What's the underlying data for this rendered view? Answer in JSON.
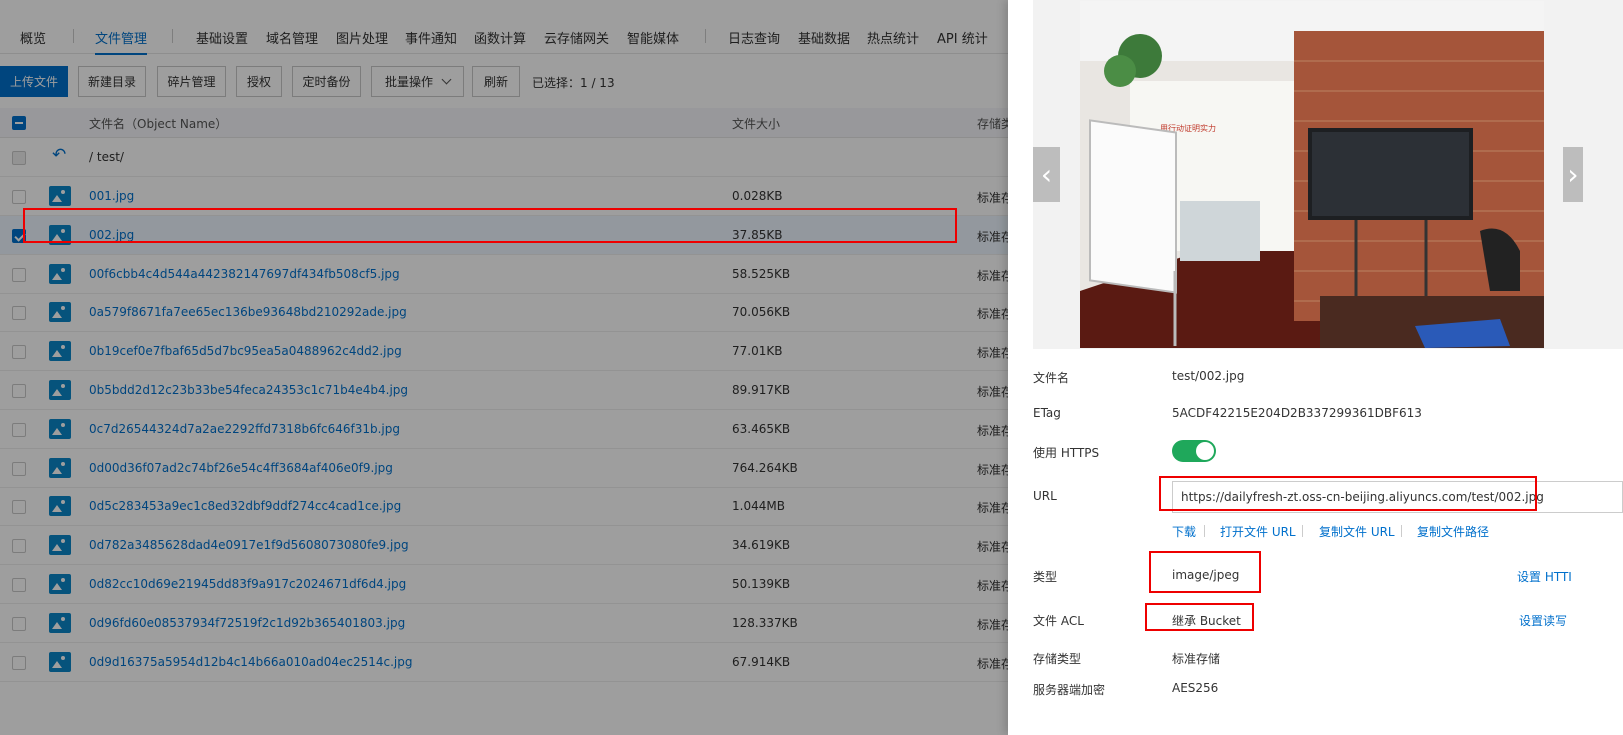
{
  "tabs": [
    {
      "label": "概览",
      "active": false
    },
    {
      "label": "文件管理",
      "active": true
    },
    {
      "label": "基础设置",
      "active": false
    },
    {
      "label": "域名管理",
      "active": false
    },
    {
      "label": "图片处理",
      "active": false
    },
    {
      "label": "事件通知",
      "active": false
    },
    {
      "label": "函数计算",
      "active": false
    },
    {
      "label": "云存储网关",
      "active": false
    },
    {
      "label": "智能媒体",
      "active": false
    },
    {
      "label": "日志查询",
      "active": false
    },
    {
      "label": "基础数据",
      "active": false
    },
    {
      "label": "热点统计",
      "active": false
    },
    {
      "label": "API 统计",
      "active": false
    }
  ],
  "toolbar": {
    "upload": "上传文件",
    "new_dir": "新建目录",
    "fragments": "碎片管理",
    "authorize": "授权",
    "backup": "定时备份",
    "batch": "批量操作",
    "refresh": "刷新",
    "selected": "已选择：1 / 13"
  },
  "table": {
    "col_name": "文件名（Object Name）",
    "col_size": "文件大小",
    "col_storage": "存储类",
    "path": "/ test/",
    "rows": [
      {
        "name": "001.jpg",
        "size": "0.028KB",
        "storage": "标准存",
        "checked": false
      },
      {
        "name": "002.jpg",
        "size": "37.85KB",
        "storage": "标准存",
        "checked": true
      },
      {
        "name": "00f6cbb4c4d544a442382147697df434fb508cf5.jpg",
        "size": "58.525KB",
        "storage": "标准存",
        "checked": false
      },
      {
        "name": "0a579f8671fa7ee65ec136be93648bd210292ade.jpg",
        "size": "70.056KB",
        "storage": "标准存",
        "checked": false
      },
      {
        "name": "0b19cef0e7fbaf65d5d7bc95ea5a0488962c4dd2.jpg",
        "size": "77.01KB",
        "storage": "标准存",
        "checked": false
      },
      {
        "name": "0b5bdd2d12c23b33be54feca24353c1c71b4e4b4.jpg",
        "size": "89.917KB",
        "storage": "标准存",
        "checked": false
      },
      {
        "name": "0c7d26544324d7a2ae2292ffd7318b6fc646f31b.jpg",
        "size": "63.465KB",
        "storage": "标准存",
        "checked": false
      },
      {
        "name": "0d00d36f07ad2c74bf26e54c4ff3684af406e0f9.jpg",
        "size": "764.264KB",
        "storage": "标准存",
        "checked": false
      },
      {
        "name": "0d5c283453a9ec1c8ed32dbf9ddf274cc4cad1ce.jpg",
        "size": "1.044MB",
        "storage": "标准存",
        "checked": false
      },
      {
        "name": "0d782a3485628dad4e0917e1f9d5608073080fe9.jpg",
        "size": "34.619KB",
        "storage": "标准存",
        "checked": false
      },
      {
        "name": "0d82cc10d69e21945dd83f9a917c2024671df6d4.jpg",
        "size": "50.139KB",
        "storage": "标准存",
        "checked": false
      },
      {
        "name": "0d96fd60e08537934f72519f2c1d92b365401803.jpg",
        "size": "128.337KB",
        "storage": "标准存",
        "checked": false
      },
      {
        "name": "0d9d16375a5954d12b4c14b66a010ad04ec2514c.jpg",
        "size": "67.914KB",
        "storage": "标准存",
        "checked": false
      }
    ]
  },
  "panel": {
    "filename_label": "文件名",
    "filename": "test/002.jpg",
    "etag_label": "ETag",
    "etag": "5ACDF42215E204D2B337299361DBF613",
    "https_label": "使用 HTTPS",
    "https_enabled": true,
    "url_label": "URL",
    "url": "https://dailyfresh-zt.oss-cn-beijing.aliyuncs.com/test/002.jpg",
    "links": [
      "下载",
      "打开文件 URL",
      "复制文件 URL",
      "复制文件路径"
    ],
    "type_label": "类型",
    "type": "image/jpeg",
    "set_http": "设置 HTTI",
    "acl_label": "文件 ACL",
    "acl": "继承 Bucket",
    "set_rw": "设置读写",
    "storage_label": "存储类型",
    "storage": "标准存储",
    "encrypt_label": "服务器端加密",
    "encrypt": "AES256",
    "photo_text": "用行动证明实力",
    "colors": {
      "accent": "#0070cc",
      "toggle": "#1fa85b",
      "highlight": "#e00000"
    }
  }
}
